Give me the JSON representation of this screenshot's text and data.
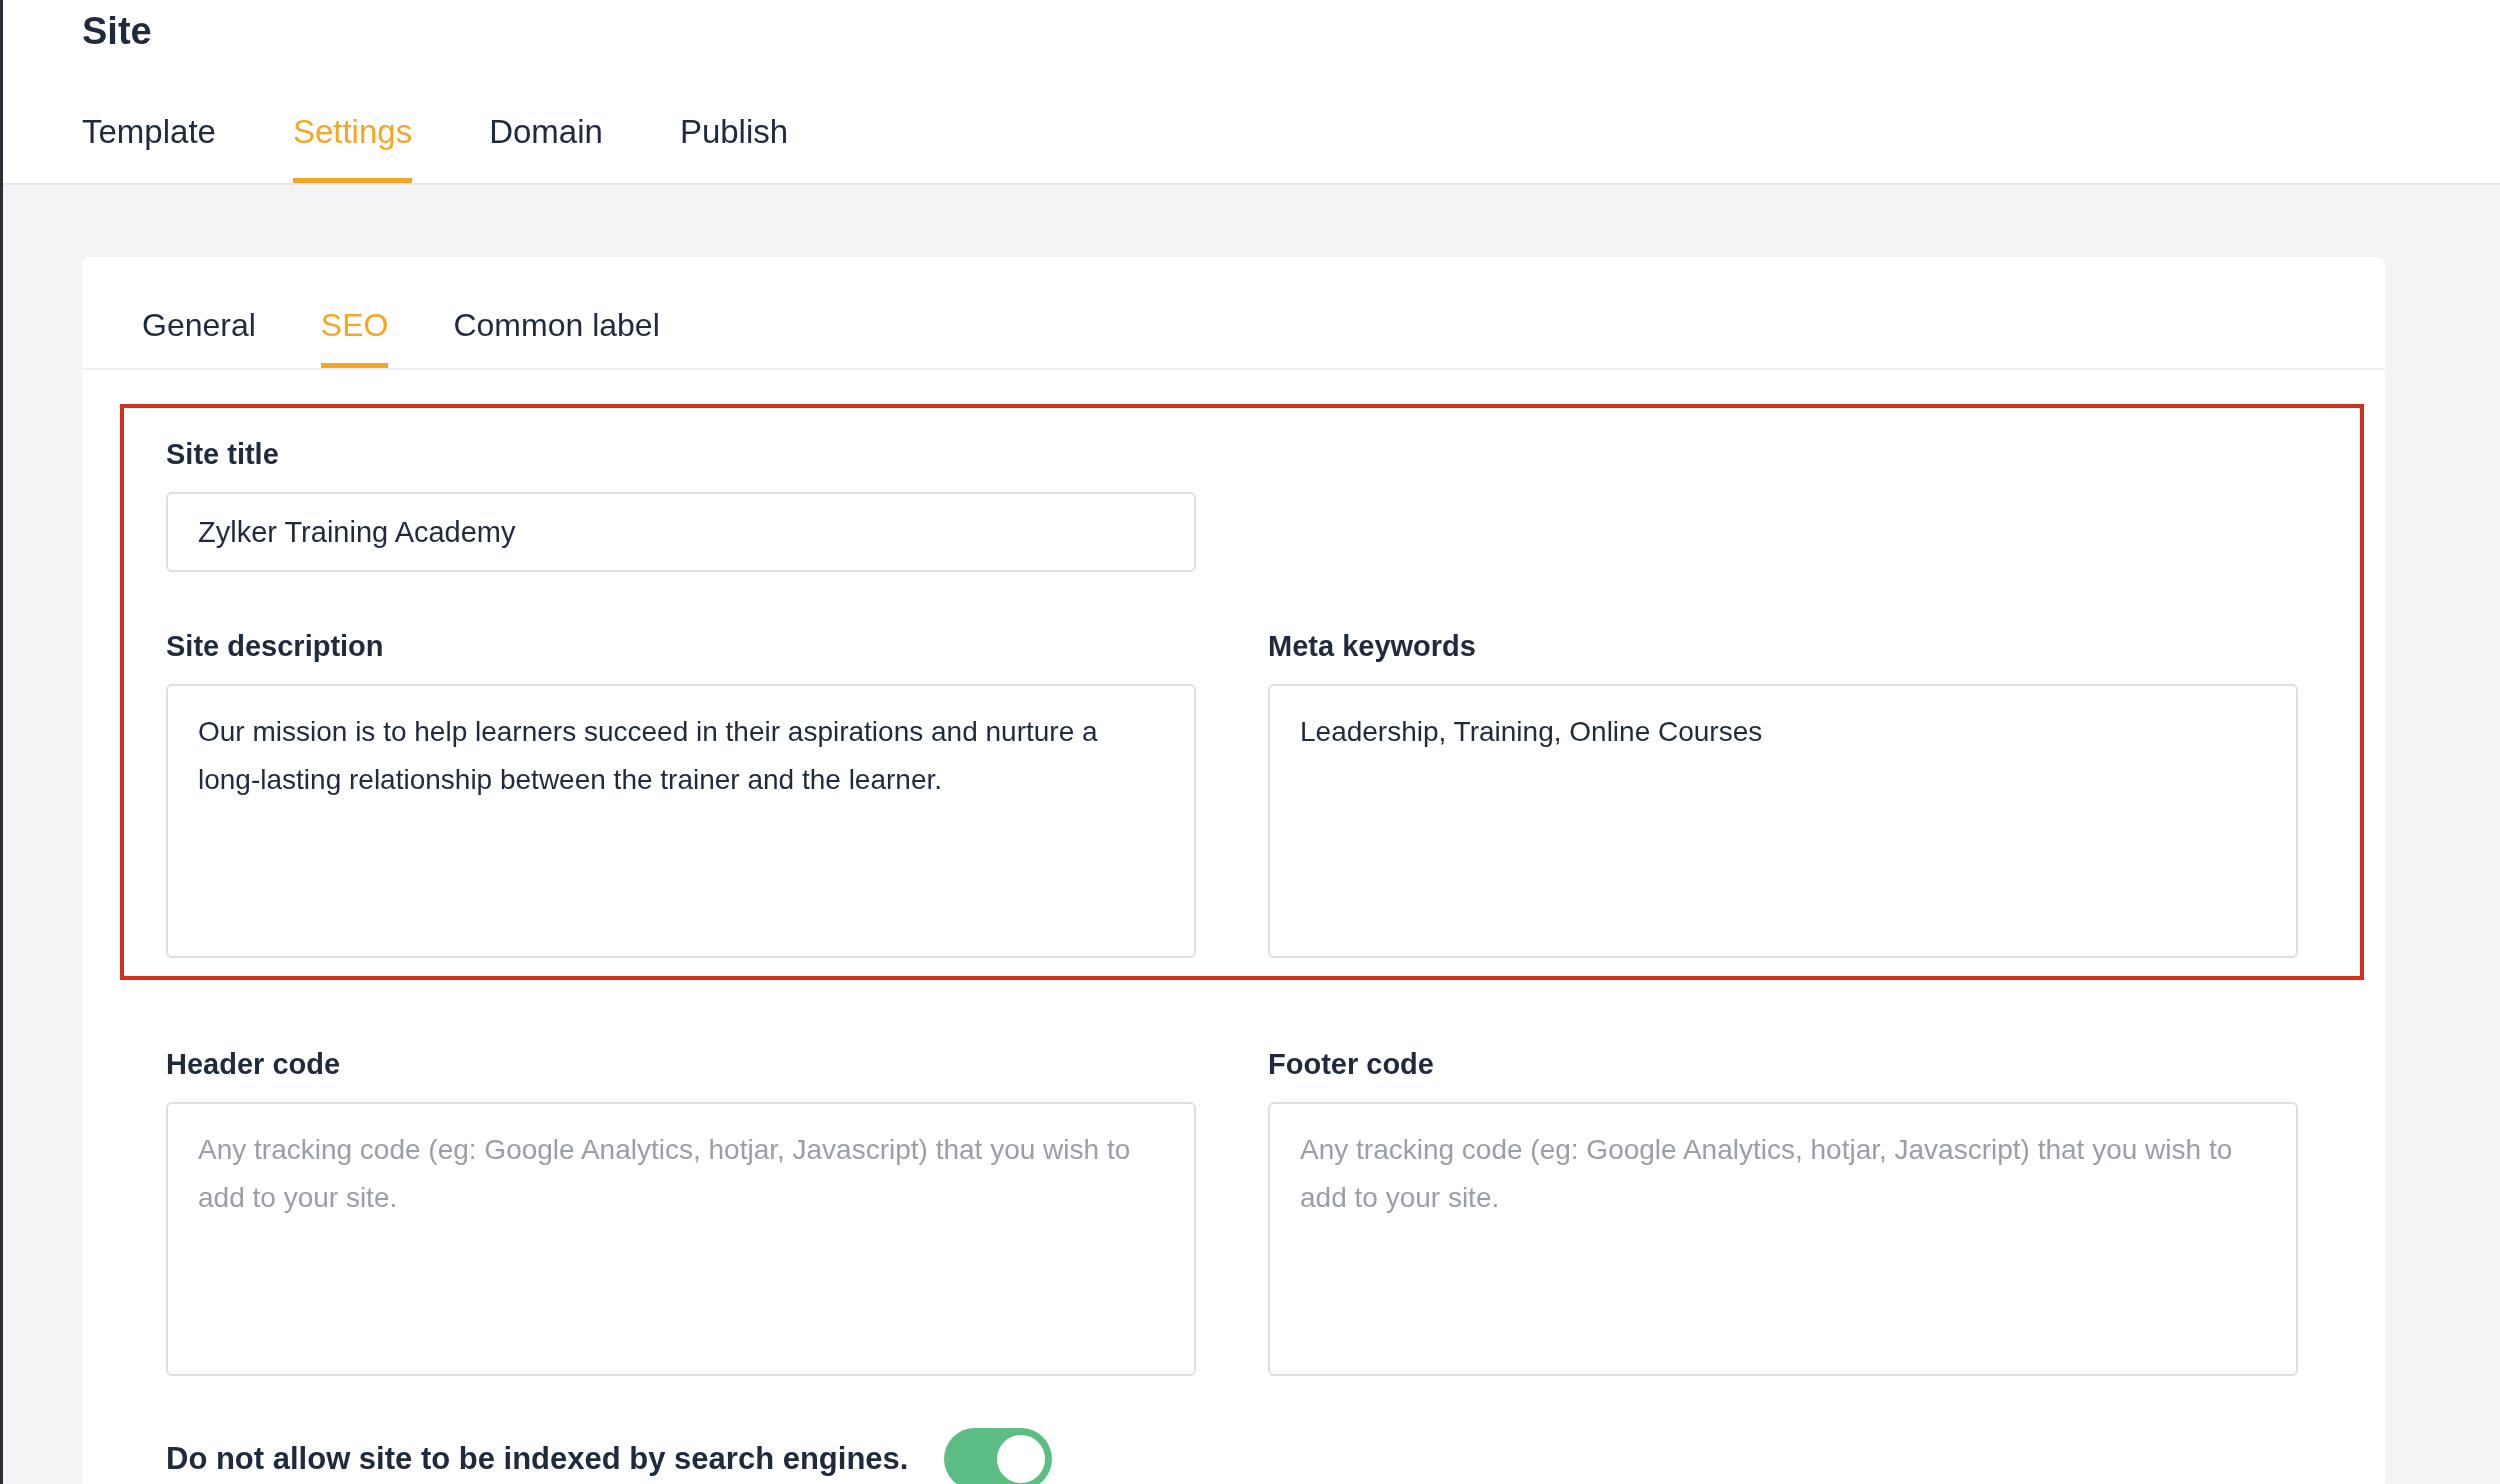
{
  "header": {
    "title": "Site",
    "tabs": [
      {
        "label": "Template",
        "selected": false
      },
      {
        "label": "Settings",
        "selected": true
      },
      {
        "label": "Domain",
        "selected": false
      },
      {
        "label": "Publish",
        "selected": false
      }
    ]
  },
  "card": {
    "tabs": [
      {
        "label": "General",
        "selected": false
      },
      {
        "label": "SEO",
        "selected": true
      },
      {
        "label": "Common label",
        "selected": false
      }
    ],
    "sections": [
      {
        "highlighted": true,
        "rows": [
          [
            {
              "kind": "input",
              "label": "Site title",
              "value": "Zylker Training Academy"
            }
          ],
          [
            {
              "kind": "textarea",
              "label": "Site description",
              "value": "Our mission is to help learners succeed in their aspirations and nurture a long-lasting relationship between the trainer and the learner."
            },
            {
              "kind": "textarea",
              "label": "Meta keywords",
              "value": "Leadership, Training, Online Courses"
            }
          ]
        ]
      },
      {
        "highlighted": false,
        "rows": [
          [
            {
              "kind": "textarea",
              "label": "Header code",
              "placeholder": "Any tracking code (eg: Google Analytics, hotjar, Javascript) that you wish to add to your site."
            },
            {
              "kind": "textarea",
              "label": "Footer code",
              "placeholder": "Any tracking code (eg: Google Analytics, hotjar, Javascript) that you wish to add to your site."
            }
          ]
        ]
      }
    ],
    "toggle": {
      "label": "Do not allow site to be indexed by search engines.",
      "on": true
    }
  }
}
